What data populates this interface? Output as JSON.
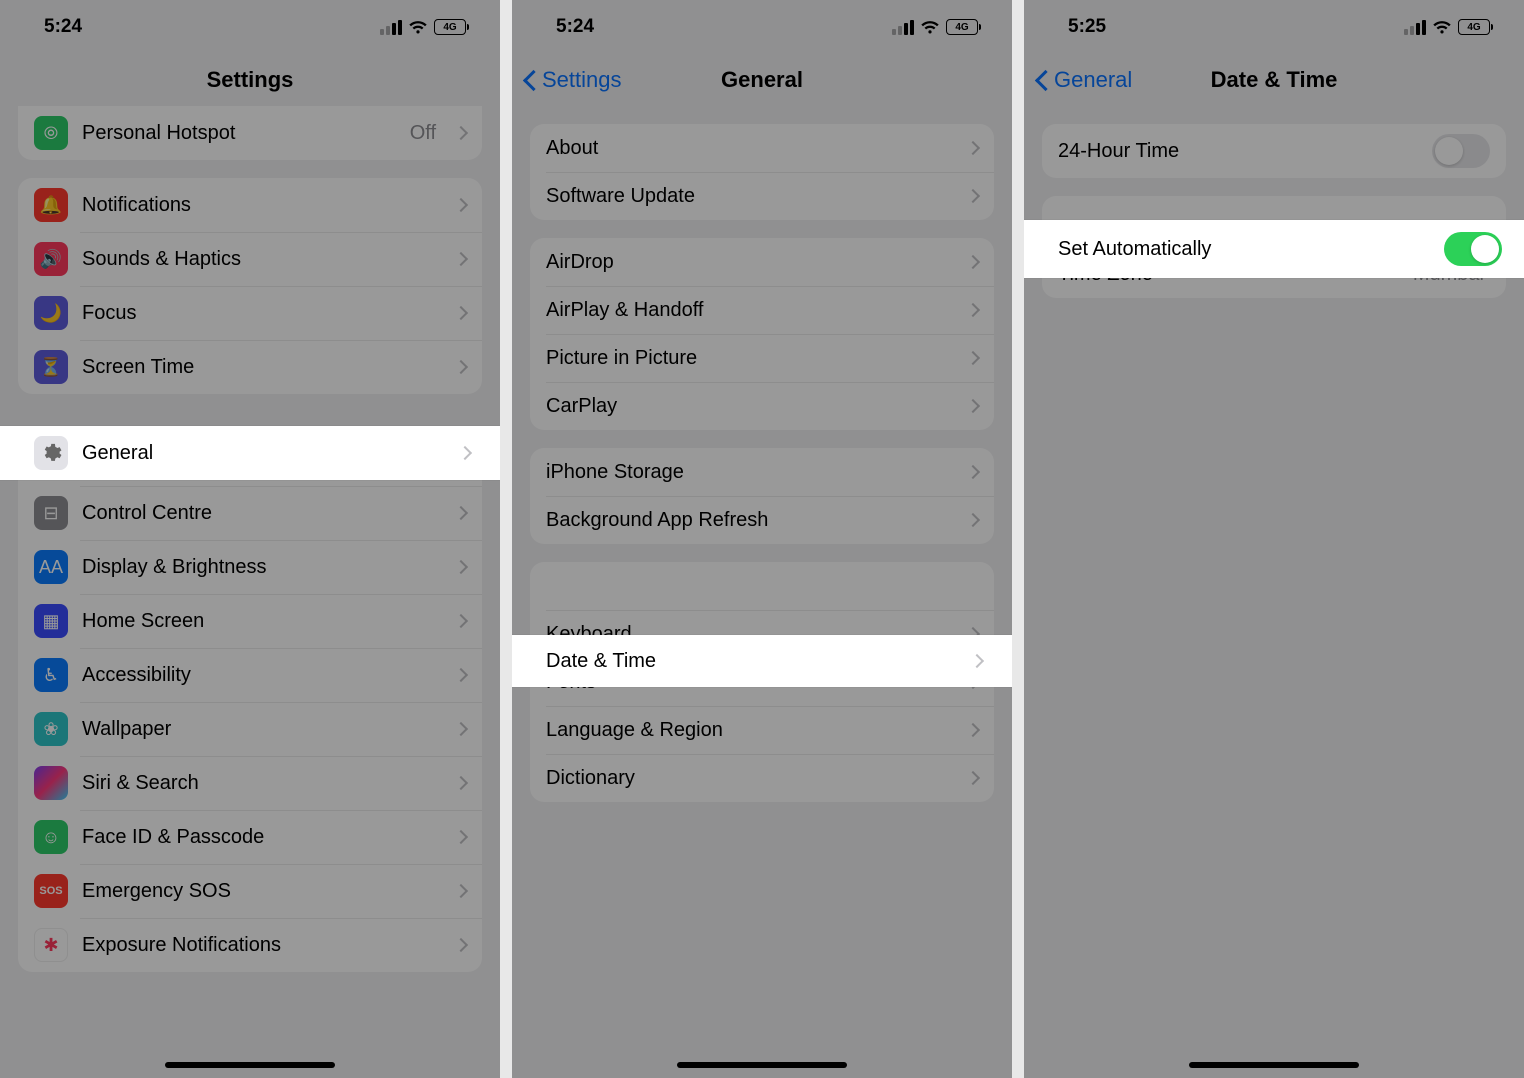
{
  "panel1": {
    "status_time": "5:24",
    "battery_label": "4G",
    "title": "Settings",
    "hotspot": {
      "label": "Personal Hotspot",
      "value": "Off"
    },
    "group2": [
      {
        "label": "Notifications"
      },
      {
        "label": "Sounds & Haptics"
      },
      {
        "label": "Focus"
      },
      {
        "label": "Screen Time"
      }
    ],
    "general_label": "General",
    "group3": [
      {
        "label": "Control Centre"
      },
      {
        "label": "Display & Brightness"
      },
      {
        "label": "Home Screen"
      },
      {
        "label": "Accessibility"
      },
      {
        "label": "Wallpaper"
      },
      {
        "label": "Siri & Search"
      },
      {
        "label": "Face ID & Passcode"
      },
      {
        "label": "Emergency SOS"
      },
      {
        "label": "Exposure Notifications"
      }
    ]
  },
  "panel2": {
    "status_time": "5:24",
    "battery_label": "4G",
    "back": "Settings",
    "title": "General",
    "g1": [
      "About",
      "Software Update"
    ],
    "g2": [
      "AirDrop",
      "AirPlay & Handoff",
      "Picture in Picture",
      "CarPlay"
    ],
    "g3": [
      "iPhone Storage",
      "Background App Refresh"
    ],
    "datetime_label": "Date & Time",
    "g4": [
      "Keyboard",
      "Fonts",
      "Language & Region",
      "Dictionary"
    ]
  },
  "panel3": {
    "status_time": "5:25",
    "battery_label": "4G",
    "back": "General",
    "title": "Date & Time",
    "row_24h": "24-Hour Time",
    "row_setauto": "Set Automatically",
    "row_tz_label": "Time Zone",
    "row_tz_value": "Mumbai"
  }
}
